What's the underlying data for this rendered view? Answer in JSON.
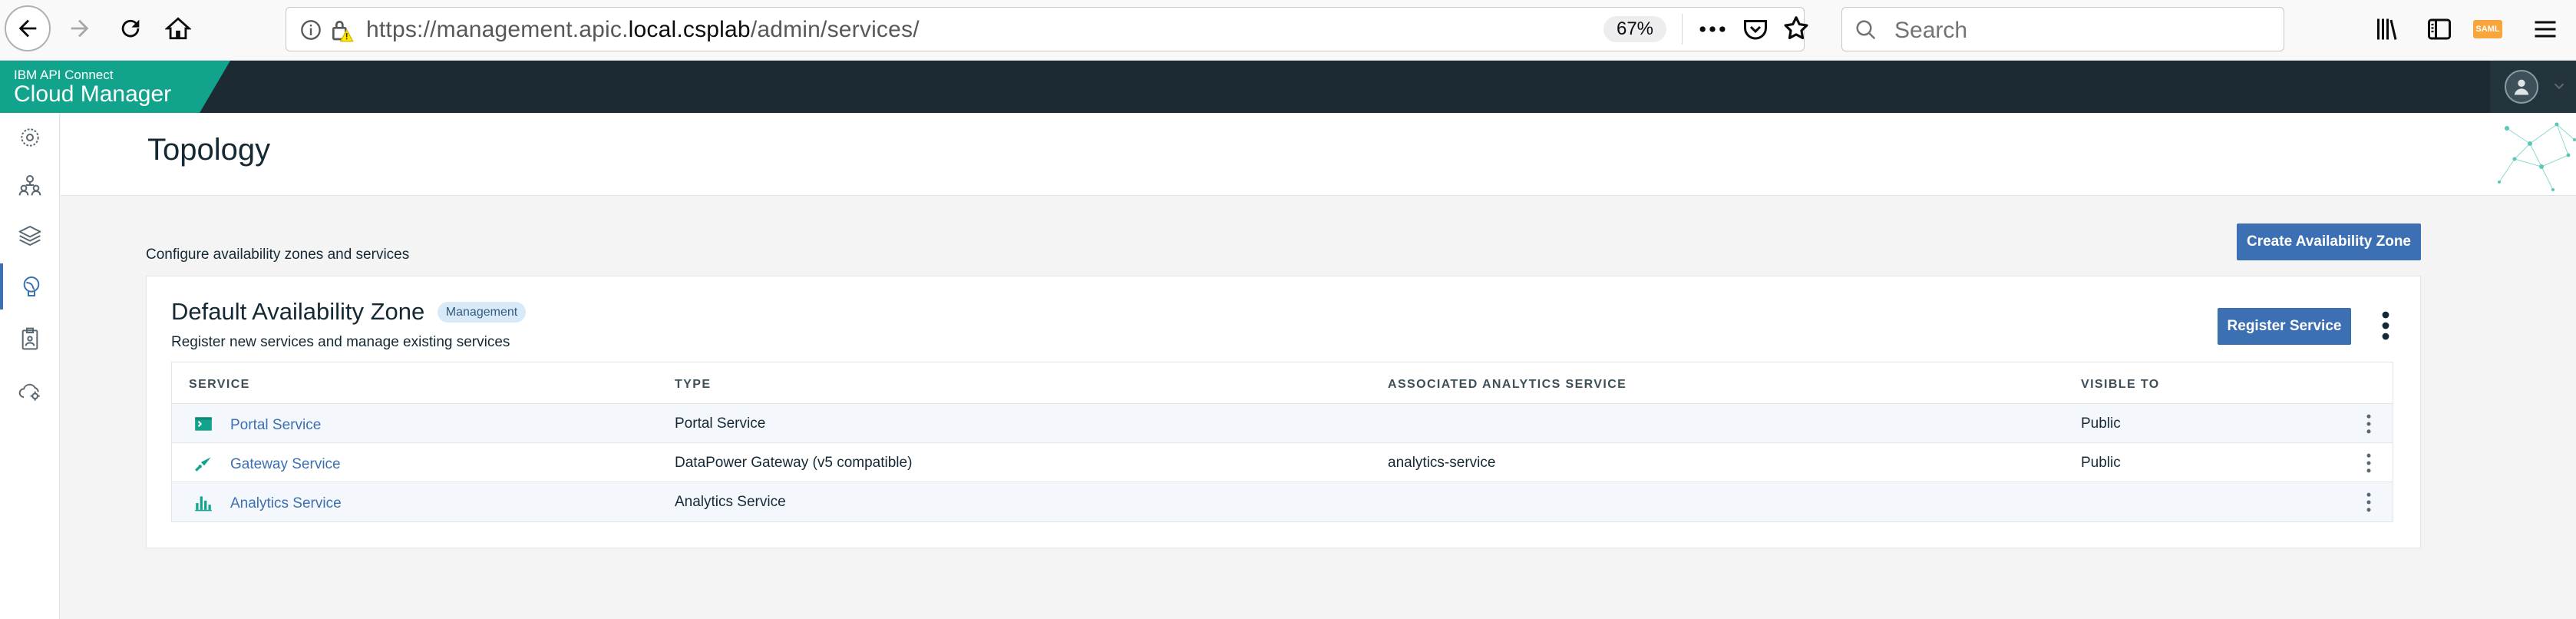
{
  "browser": {
    "url_prefix": "https://management.apic.",
    "url_domain": "local.csplab",
    "url_path": "/admin/services/",
    "zoom": "67%",
    "search_placeholder": "Search",
    "saml_badge": "SAML"
  },
  "app": {
    "product": "IBM API Connect",
    "name": "Cloud Manager"
  },
  "nav": {
    "items": [
      {
        "icon": "dashboard-icon"
      },
      {
        "icon": "members-icon"
      },
      {
        "icon": "resources-icon"
      },
      {
        "icon": "topology-icon",
        "active": true
      },
      {
        "icon": "provider-orgs-icon"
      },
      {
        "icon": "cloud-settings-icon"
      }
    ]
  },
  "page": {
    "title": "Topology",
    "description": "Configure availability zones and services",
    "create_button": "Create Availability Zone"
  },
  "zone": {
    "title": "Default Availability Zone",
    "badge": "Management",
    "description": "Register new services and manage existing services",
    "register_button": "Register Service",
    "columns": [
      "SERVICE",
      "TYPE",
      "ASSOCIATED ANALYTICS SERVICE",
      "VISIBLE TO"
    ],
    "rows": [
      {
        "icon": "portal-icon",
        "service": "Portal Service",
        "type": "Portal Service",
        "analytics": "",
        "visible": "Public"
      },
      {
        "icon": "gateway-icon",
        "service": "Gateway Service",
        "type": "DataPower Gateway (v5 compatible)",
        "analytics": "analytics-service",
        "visible": "Public"
      },
      {
        "icon": "analytics-icon",
        "service": "Analytics Service",
        "type": "Analytics Service",
        "analytics": "",
        "visible": ""
      }
    ]
  },
  "colors": {
    "brand_green": "#12a38d",
    "header_dark": "#1c2b33",
    "primary_blue": "#3d70b2",
    "badge_bg": "#d8eaf7"
  }
}
